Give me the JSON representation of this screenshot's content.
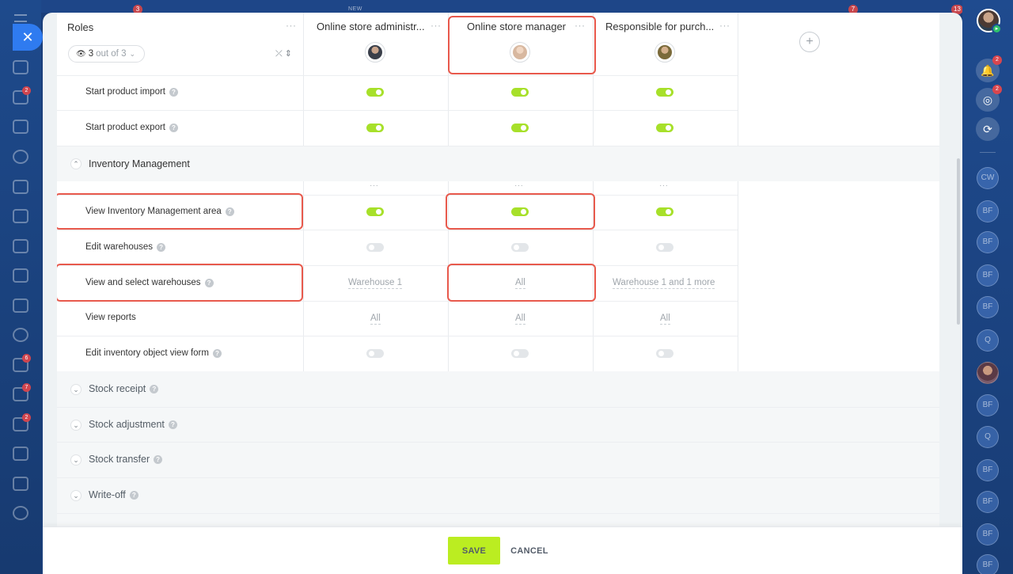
{
  "background": {
    "top_badges": [
      "3",
      "7",
      "13"
    ],
    "top_new_label": "NEW",
    "left_badges": [
      "2",
      "6",
      "7",
      "2"
    ],
    "right_rail": {
      "notifications_badge": "2",
      "feed_badge": "2",
      "avatars": [
        "CW",
        "BF",
        "BF",
        "BF",
        "BF",
        "Q",
        "BF",
        "Q",
        "BF",
        "BF",
        "BF",
        "BF"
      ]
    }
  },
  "header": {
    "roles_title": "Roles",
    "count_value": "3",
    "count_suffix": "out of 3",
    "columns": [
      {
        "title": "Online store administr...",
        "avatar_color": "#3a3f4a"
      },
      {
        "title": "Online store manager",
        "avatar_color": "#d8b8a0"
      },
      {
        "title": "Responsible for purch...",
        "avatar_color": "#7a6a3a"
      }
    ]
  },
  "rows_top": [
    {
      "label": "Start product import",
      "values": [
        "on",
        "on",
        "on"
      ]
    },
    {
      "label": "Start product export",
      "values": [
        "on",
        "on",
        "on"
      ]
    }
  ],
  "section": {
    "title": "Inventory Management",
    "rows": [
      {
        "label": "View Inventory Management area",
        "type": "toggle",
        "values": [
          "on",
          "on",
          "on"
        ]
      },
      {
        "label": "Edit warehouses",
        "type": "toggle",
        "values": [
          "off",
          "off",
          "off"
        ]
      },
      {
        "label": "View and select warehouses",
        "type": "text",
        "values": [
          "Warehouse 1",
          "All",
          "Warehouse 1 and 1 more"
        ]
      },
      {
        "label": "View reports",
        "type": "text",
        "values": [
          "All",
          "All",
          "All"
        ]
      },
      {
        "label": "Edit inventory object view form",
        "type": "toggle",
        "values": [
          "off",
          "off",
          "off"
        ]
      }
    ]
  },
  "collapsed_sections": [
    "Stock receipt",
    "Stock adjustment",
    "Stock transfer",
    "Write-off"
  ],
  "footer": {
    "save_label": "SAVE",
    "cancel_label": "CANCEL"
  },
  "colors": {
    "toggle_on": "#a7e02a",
    "toggle_off": "#e3e6e9",
    "save": "#bbed21",
    "highlight": "#e8594c",
    "accent": "#2f7bf0"
  }
}
